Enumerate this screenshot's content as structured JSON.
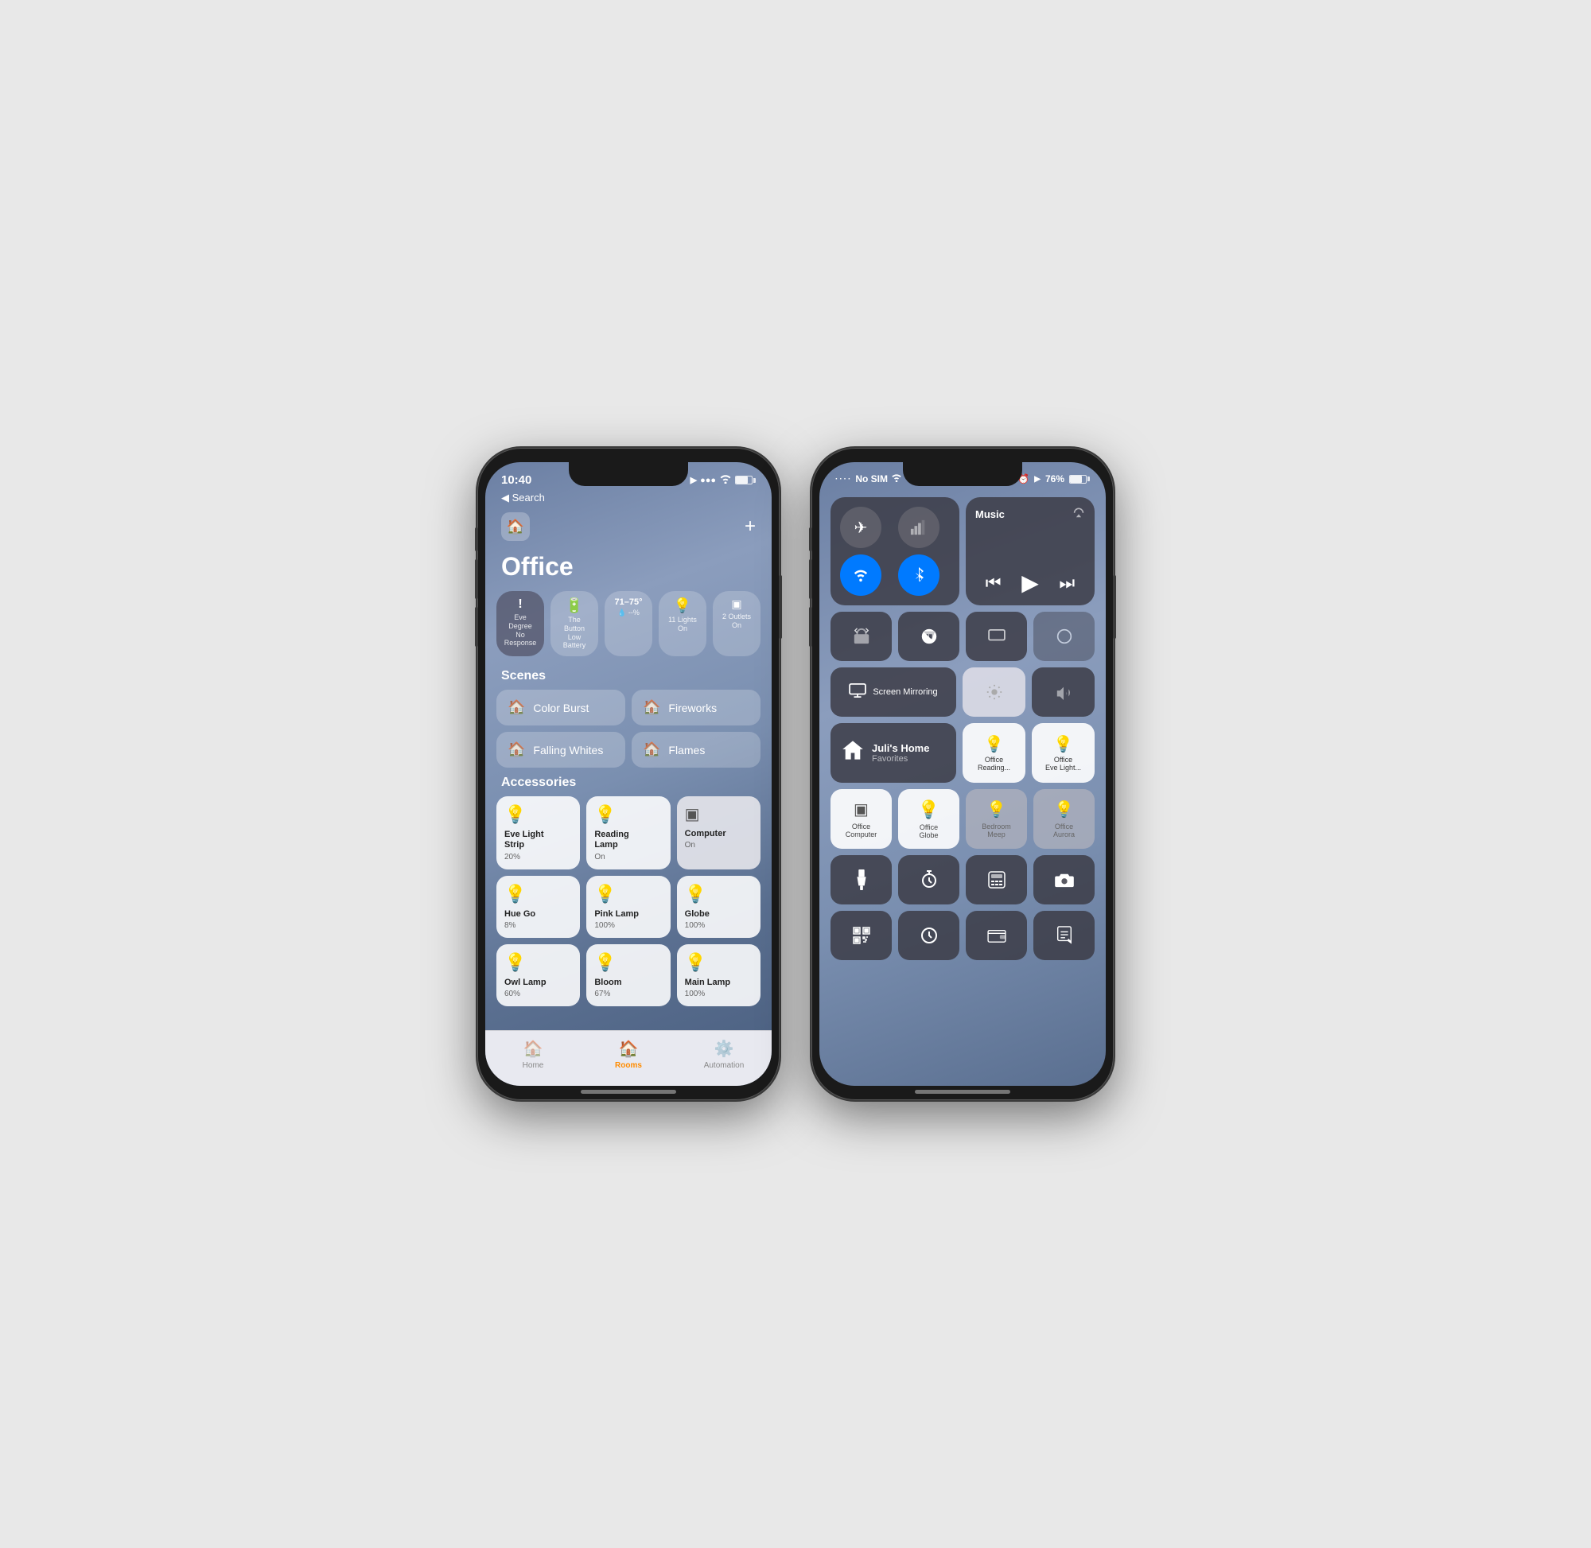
{
  "phone1": {
    "statusBar": {
      "time": "10:40",
      "locationIcon": "▶",
      "signalDots": "···",
      "wifiIcon": "wifi",
      "batteryPct": ""
    },
    "nav": {
      "backLabel": "◀ Search"
    },
    "homeIcon": "🏠",
    "addIcon": "+",
    "title": "Office",
    "statusPills": [
      {
        "icon": "!",
        "label": "Eve Degree\nNo Response",
        "bg": "dark"
      },
      {
        "icon": "🔋",
        "label": "The Button\nLow Battery",
        "bg": "normal"
      },
      {
        "icon": "71–75°",
        "label": "  --%",
        "bg": "normal",
        "subIcon": "💧"
      },
      {
        "icon": "💡",
        "label": "11 Lights\nOn",
        "bg": "yellow"
      },
      {
        "icon": "🔌",
        "label": "2 Outlets\nOn",
        "bg": "normal"
      }
    ],
    "scenesTitle": "Scenes",
    "scenes": [
      {
        "label": "Color Burst"
      },
      {
        "label": "Fireworks"
      },
      {
        "label": "Falling Whites"
      },
      {
        "label": "Flames"
      }
    ],
    "accessoriesTitle": "Accessories",
    "accessories": [
      {
        "icon": "💡",
        "name": "Eve Light\nStrip",
        "status": "20%",
        "type": "light"
      },
      {
        "icon": "💡",
        "name": "Reading\nLamp",
        "status": "On",
        "type": "light"
      },
      {
        "icon": "outlet",
        "name": "Computer",
        "status": "On",
        "type": "outlet"
      },
      {
        "icon": "💡",
        "name": "Hue Go",
        "status": "8%",
        "type": "light"
      },
      {
        "icon": "💡",
        "name": "Pink Lamp",
        "status": "100%",
        "type": "light"
      },
      {
        "icon": "💡",
        "name": "Globe",
        "status": "100%",
        "type": "light"
      },
      {
        "icon": "💡",
        "name": "Owl Lamp",
        "status": "60%",
        "type": "light"
      },
      {
        "icon": "💡",
        "name": "Bloom",
        "status": "67%",
        "type": "light"
      },
      {
        "icon": "💡",
        "name": "Main Lamp",
        "status": "100%",
        "type": "light"
      }
    ],
    "tabs": [
      {
        "icon": "🏠",
        "label": "Home",
        "active": false
      },
      {
        "icon": "🏠",
        "label": "Rooms",
        "active": true
      },
      {
        "icon": "⚙️",
        "label": "Automation",
        "active": false
      }
    ]
  },
  "phone2": {
    "statusBar": {
      "dots": "····",
      "carrier": "No SIM",
      "wifiLabel": "wifi",
      "alarmIcon": "⏰",
      "locationIcon": "▶",
      "batteryPct": "76%",
      "batteryLabel": "battery"
    },
    "connectivity": {
      "airplaneMode": "✈",
      "cellularLabel": "cell",
      "wifiLabel": "wifi-active",
      "bluetoothLabel": "bluetooth"
    },
    "music": {
      "title": "Music",
      "airplayIcon": "airplay"
    },
    "row2Buttons": [
      {
        "icon": "🔄",
        "label": "portrait-lock",
        "active": false
      },
      {
        "icon": "🌙",
        "label": "do-not-disturb",
        "active": false
      },
      {
        "icon": "📺",
        "label": "screen-mirror-label",
        "active": false
      },
      {
        "icon": "blank",
        "label": "blank4",
        "active": false
      }
    ],
    "screenMirror": {
      "label": "Screen\nMirroring"
    },
    "brightness": {
      "label": "brightness"
    },
    "volume": {
      "label": "volume"
    },
    "homeTile": {
      "label": "Juli's Home",
      "sublabel": "Favorites"
    },
    "controlTiles": [
      {
        "icon": "💡",
        "label": "Office\nReading...",
        "type": "light"
      },
      {
        "icon": "💡",
        "label": "Office\nEve Light...",
        "type": "light"
      }
    ],
    "row5Tiles": [
      {
        "icon": "outlet",
        "label": "Office\nComputer",
        "type": "outlet"
      },
      {
        "icon": "💡",
        "label": "Office\nGlobe",
        "type": "light"
      },
      {
        "icon": "💡",
        "label": "Bedroom\nMeep",
        "type": "light-dim"
      },
      {
        "icon": "💡",
        "label": "Office\nAurora",
        "type": "light-dim"
      }
    ],
    "row6Tiles": [
      {
        "icon": "🔦",
        "label": "flashlight"
      },
      {
        "icon": "⏱",
        "label": "timer"
      },
      {
        "icon": "🧮",
        "label": "calculator"
      },
      {
        "icon": "📷",
        "label": "camera"
      }
    ],
    "row7Tiles": [
      {
        "icon": "⊙",
        "label": "qr-scan"
      },
      {
        "icon": "⏰",
        "label": "clock"
      },
      {
        "icon": "💳",
        "label": "wallet"
      },
      {
        "icon": "✏",
        "label": "notes"
      }
    ]
  }
}
